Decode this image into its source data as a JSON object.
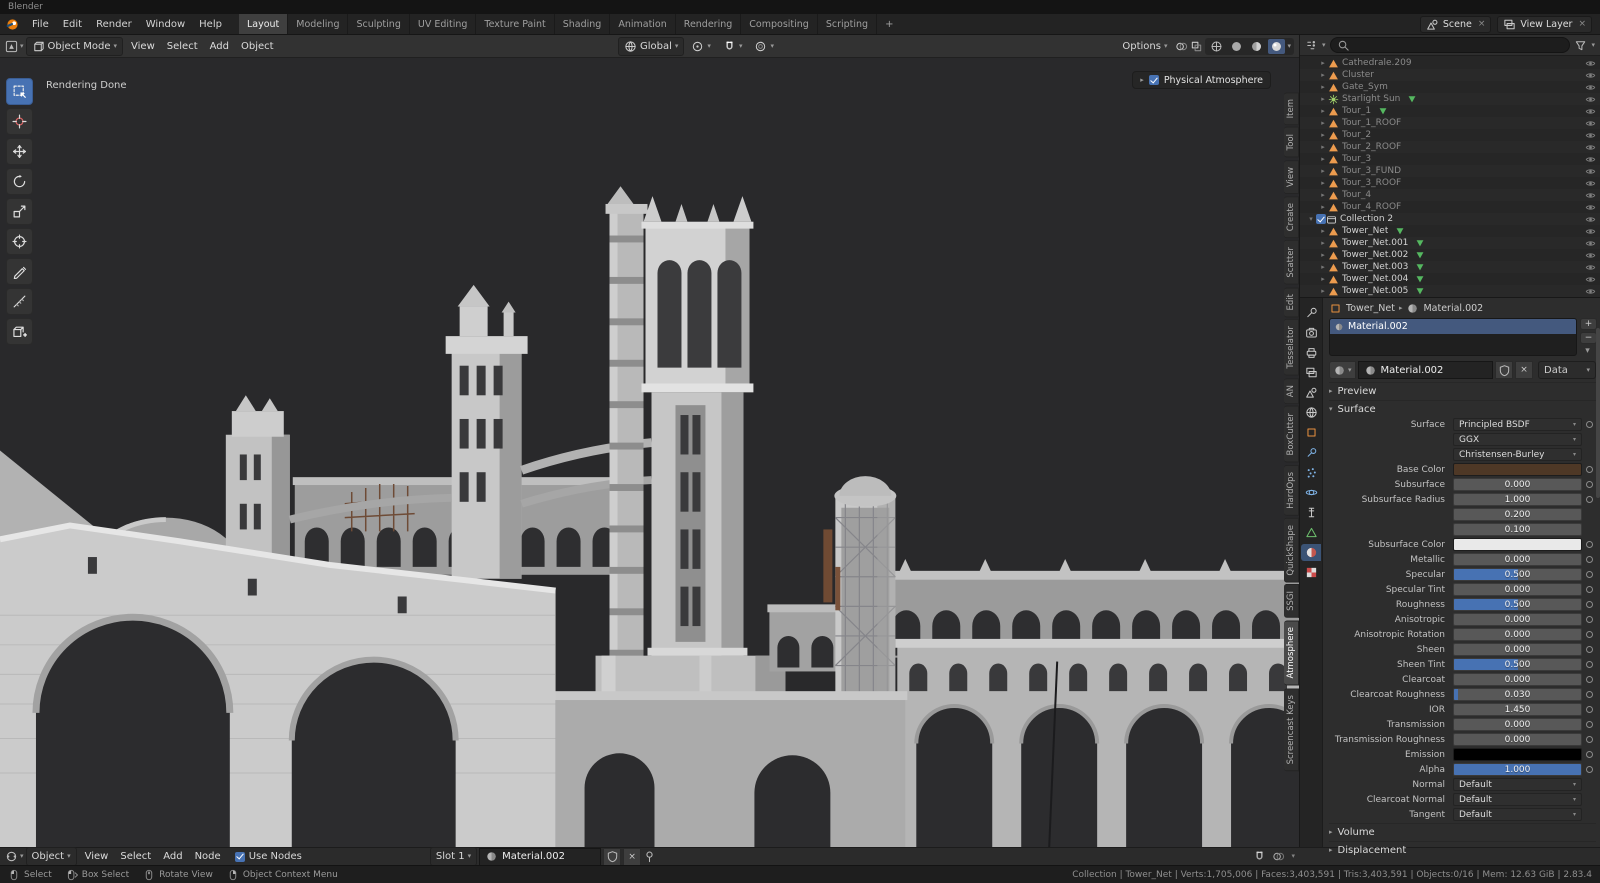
{
  "window": {
    "title": "Blender"
  },
  "icons": {
    "caret_down": "▾",
    "caret_right": "▸",
    "separator": "▸",
    "close": "×",
    "plus": "+",
    "minus": "−"
  },
  "topbar": {
    "menus": [
      "File",
      "Edit",
      "Render",
      "Window",
      "Help"
    ],
    "workspaces": [
      {
        "label": "Layout",
        "active": true
      },
      {
        "label": "Modeling"
      },
      {
        "label": "Sculpting"
      },
      {
        "label": "UV Editing"
      },
      {
        "label": "Texture Paint"
      },
      {
        "label": "Shading"
      },
      {
        "label": "Animation"
      },
      {
        "label": "Rendering"
      },
      {
        "label": "Compositing"
      },
      {
        "label": "Scripting"
      }
    ],
    "add_workspace": "+",
    "scene_name": "Scene",
    "view_layer_name": "View Layer"
  },
  "viewport": {
    "header": {
      "mode": "Object Mode",
      "menus": [
        "View",
        "Select",
        "Add",
        "Object"
      ],
      "orientation": "Global",
      "options_label": "Options"
    },
    "render_status": "Rendering Done",
    "overlay_label": "Physical Atmosphere",
    "sidebar_tabs": [
      "Item",
      "Tool",
      "View",
      "Create",
      "Scatter",
      "Edit",
      "Tesselator",
      "AN",
      "BoxCutter",
      "HardOps",
      "QuickShape",
      "SSGI",
      "Atmosphere",
      "Screencast Keys"
    ],
    "active_sidebar_tab": "Atmosphere",
    "tools": [
      "select-box",
      "cursor",
      "move",
      "rotate",
      "scale",
      "transform",
      "annotate",
      "measure",
      "add-cube"
    ]
  },
  "outliner": {
    "items": [
      {
        "name": "Cathedrale.209",
        "icon": "mesh",
        "dim": true
      },
      {
        "name": "Cluster",
        "icon": "mesh",
        "dim": true
      },
      {
        "name": "Gate_Sym",
        "icon": "mesh",
        "dim": true
      },
      {
        "name": "Starlight Sun",
        "icon": "light",
        "dim": true,
        "extra": true
      },
      {
        "name": "Tour_1",
        "icon": "mesh",
        "dim": true,
        "extra": true
      },
      {
        "name": "Tour_1_ROOF",
        "icon": "mesh",
        "dim": true
      },
      {
        "name": "Tour_2",
        "icon": "mesh",
        "dim": true
      },
      {
        "name": "Tour_2_ROOF",
        "icon": "mesh",
        "dim": true
      },
      {
        "name": "Tour_3",
        "icon": "mesh",
        "dim": true
      },
      {
        "name": "Tour_3_FUND",
        "icon": "mesh",
        "dim": true
      },
      {
        "name": "Tour_3_ROOF",
        "icon": "mesh",
        "dim": true
      },
      {
        "name": "Tour_4",
        "icon": "mesh",
        "dim": true
      },
      {
        "name": "Tour_4_ROOF",
        "icon": "mesh",
        "dim": true
      },
      {
        "name": "Collection 2",
        "icon": "collection",
        "checkbox": true,
        "collection": true
      },
      {
        "name": "Tower_Net",
        "icon": "mesh",
        "extra": true
      },
      {
        "name": "Tower_Net.001",
        "icon": "mesh",
        "extra": true
      },
      {
        "name": "Tower_Net.002",
        "icon": "mesh",
        "extra": true
      },
      {
        "name": "Tower_Net.003",
        "icon": "mesh",
        "extra": true
      },
      {
        "name": "Tower_Net.004",
        "icon": "mesh",
        "extra": true
      },
      {
        "name": "Tower_Net.005",
        "icon": "mesh",
        "extra": true
      }
    ]
  },
  "properties": {
    "tabs": [
      "tool",
      "render",
      "output",
      "view-layer",
      "scene",
      "world",
      "object",
      "modifiers",
      "particles",
      "physics",
      "constraints",
      "data",
      "material",
      "texture"
    ],
    "active_tab": "material",
    "breadcrumb": {
      "object": "Tower_Net",
      "material": "Material.002"
    },
    "slots": [
      {
        "name": "Material.002",
        "selected": true
      }
    ],
    "datablock": {
      "name": "Material.002",
      "link": "Data"
    },
    "panels": {
      "preview": "Preview",
      "surface": "Surface",
      "volume": "Volume",
      "displacement": "Displacement"
    },
    "surface_rows": [
      {
        "label": "Surface",
        "type": "menu",
        "value": "Principled BSDF",
        "dot": true
      },
      {
        "label": "",
        "type": "drop",
        "value": "GGX",
        "dot": false
      },
      {
        "label": "",
        "type": "drop",
        "value": "Christensen-Burley",
        "dot": false
      },
      {
        "label": "Base Color",
        "type": "color",
        "value": "#4e3826",
        "dot": true
      },
      {
        "label": "Subsurface",
        "type": "slider",
        "value": "0.000",
        "fill": 0,
        "dot": true
      },
      {
        "label": "Subsurface Radius",
        "type": "value",
        "value": "1.000",
        "dot": true
      },
      {
        "label": "",
        "type": "value",
        "value": "0.200",
        "dot": false
      },
      {
        "label": "",
        "type": "value",
        "value": "0.100",
        "dot": false
      },
      {
        "label": "Subsurface Color",
        "type": "color",
        "value": "#e9e9e9",
        "dot": true
      },
      {
        "label": "Metallic",
        "type": "slider",
        "value": "0.000",
        "fill": 0,
        "dot": true
      },
      {
        "label": "Specular",
        "type": "slider",
        "value": "0.500",
        "fill": 0.5,
        "dot": true
      },
      {
        "label": "Specular Tint",
        "type": "slider",
        "value": "0.000",
        "fill": 0,
        "dot": true
      },
      {
        "label": "Roughness",
        "type": "slider",
        "value": "0.500",
        "fill": 0.5,
        "dot": true
      },
      {
        "label": "Anisotropic",
        "type": "slider",
        "value": "0.000",
        "fill": 0,
        "dot": true
      },
      {
        "label": "Anisotropic Rotation",
        "type": "slider",
        "value": "0.000",
        "fill": 0,
        "dot": true
      },
      {
        "label": "Sheen",
        "type": "slider",
        "value": "0.000",
        "fill": 0,
        "dot": true
      },
      {
        "label": "Sheen Tint",
        "type": "slider",
        "value": "0.500",
        "fill": 0.5,
        "dot": true
      },
      {
        "label": "Clearcoat",
        "type": "slider",
        "value": "0.000",
        "fill": 0,
        "dot": true
      },
      {
        "label": "Clearcoat Roughness",
        "type": "slider",
        "value": "0.030",
        "fill": 0.03,
        "dot": true
      },
      {
        "label": "IOR",
        "type": "value",
        "value": "1.450",
        "dot": true
      },
      {
        "label": "Transmission",
        "type": "slider",
        "value": "0.000",
        "fill": 0,
        "dot": true
      },
      {
        "label": "Transmission Roughness",
        "type": "slider",
        "value": "0.000",
        "fill": 0,
        "dot": true
      },
      {
        "label": "Emission",
        "type": "color",
        "value": "#000000",
        "dot": true
      },
      {
        "label": "Alpha",
        "type": "slider",
        "value": "1.000",
        "fill": 1,
        "dot": true
      },
      {
        "label": "Normal",
        "type": "drop",
        "value": "Default",
        "dot": false
      },
      {
        "label": "Clearcoat Normal",
        "type": "drop",
        "value": "Default",
        "dot": false
      },
      {
        "label": "Tangent",
        "type": "drop",
        "value": "Default",
        "dot": false
      }
    ]
  },
  "shader_editor": {
    "type_label": "Object",
    "menus": [
      "View",
      "Select",
      "Add",
      "Node"
    ],
    "use_nodes_label": "Use Nodes",
    "slot_label": "Slot 1",
    "material_name": "Material.002"
  },
  "statusbar": {
    "hints": [
      {
        "icon": "mouse-left",
        "label": "Select"
      },
      {
        "icon": "mouse-left-drag",
        "label": "Box Select"
      },
      {
        "icon": "mouse-middle",
        "label": "Rotate View"
      },
      {
        "icon": "mouse-right",
        "label": "Object Context Menu"
      }
    ],
    "stats": "Collection | Tower_Net | Verts:1,705,006 | Faces:3,403,591 | Tris:3,403,591 | Objects:0/16 | Mem: 12.63 GiB | 2.83.4"
  },
  "colors": {
    "accent": "#4772b3",
    "object_orange": "#e8913f",
    "data_green": "#55b860"
  }
}
